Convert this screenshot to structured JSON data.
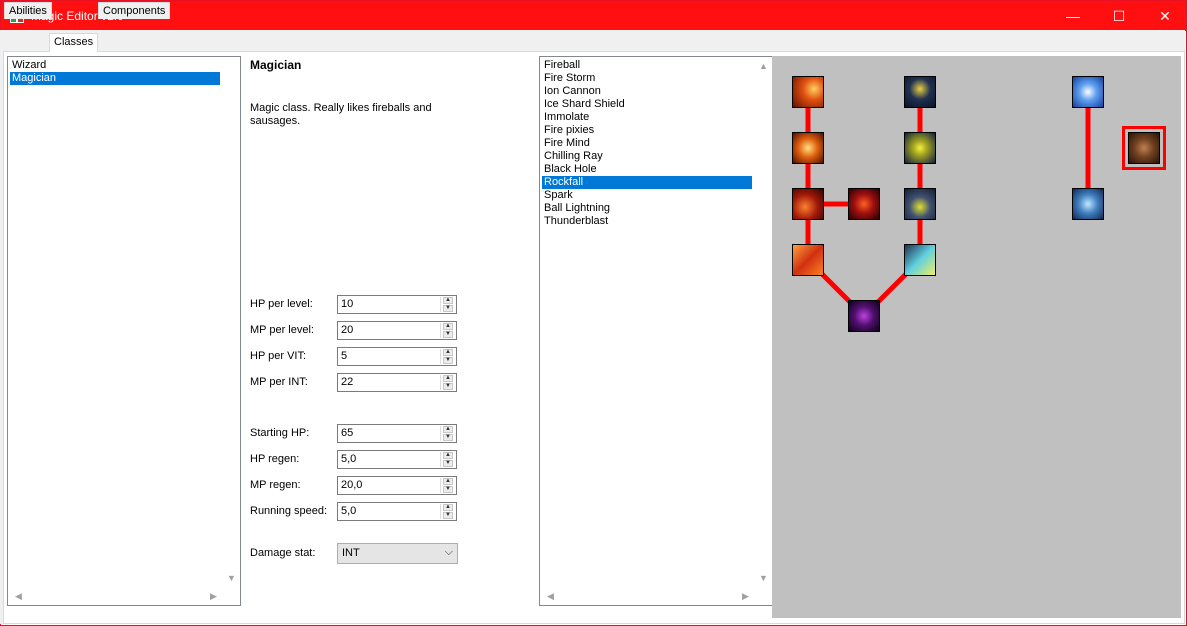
{
  "window": {
    "title": "Magic Editor v1.0",
    "minimize": "—",
    "maximize": "☐",
    "close": "✕"
  },
  "tabs": [
    {
      "label": "Abilities"
    },
    {
      "label": "Classes"
    },
    {
      "label": "Components"
    }
  ],
  "active_tab": "Classes",
  "class_list": {
    "items": [
      "Wizard",
      "Magician"
    ],
    "selected": "Magician"
  },
  "class_detail": {
    "name": "Magician",
    "description": "Magic class. Really likes fireballs and sausages.",
    "fields": [
      {
        "label": "HP per level:",
        "value": "10"
      },
      {
        "label": "MP per level:",
        "value": "20"
      },
      {
        "label": "HP per VIT:",
        "value": "5"
      },
      {
        "label": "MP per INT:",
        "value": "22"
      },
      {
        "label": "Starting HP:",
        "value": "65"
      },
      {
        "label": "HP regen:",
        "value": "5,0"
      },
      {
        "label": "MP regen:",
        "value": "20,0"
      },
      {
        "label": "Running speed:",
        "value": "5,0"
      }
    ],
    "damage_stat": {
      "label": "Damage stat:",
      "value": "INT"
    }
  },
  "ability_list": {
    "items": [
      "Fireball",
      "Fire Storm",
      "Ion Cannon",
      "Ice Shard Shield",
      "Immolate",
      "Fire pixies",
      "Fire Mind",
      "Chilling Ray",
      "Black Hole",
      "Rockfall",
      "Spark",
      "Ball Lightning",
      "Thunderblast"
    ],
    "selected": "Rockfall"
  },
  "skill_tree": {
    "colors": {
      "background": "#c0c0c0",
      "link": "#ff0000",
      "selection": "#ff0000"
    },
    "nodes": [
      {
        "name": "fireball-icon",
        "style": "fire"
      },
      {
        "name": "fire-storm-icon",
        "style": "fire"
      },
      {
        "name": "immolate-icon",
        "style": "fire"
      },
      {
        "name": "fire-pixies-icon",
        "style": "fire"
      },
      {
        "name": "fire-mind-icon",
        "style": "fire"
      },
      {
        "name": "spark-icon",
        "style": "lightning"
      },
      {
        "name": "ball-lightning-icon",
        "style": "lightning"
      },
      {
        "name": "thunderblast-icon",
        "style": "lightning"
      },
      {
        "name": "ion-cannon-icon",
        "style": "lightning"
      },
      {
        "name": "black-hole-icon",
        "style": "void"
      },
      {
        "name": "chilling-ray-icon",
        "style": "ice"
      },
      {
        "name": "ice-shard-shield-icon",
        "style": "ice"
      },
      {
        "name": "rockfall-icon",
        "style": "rock"
      }
    ],
    "selected_node": "rockfall-icon"
  }
}
